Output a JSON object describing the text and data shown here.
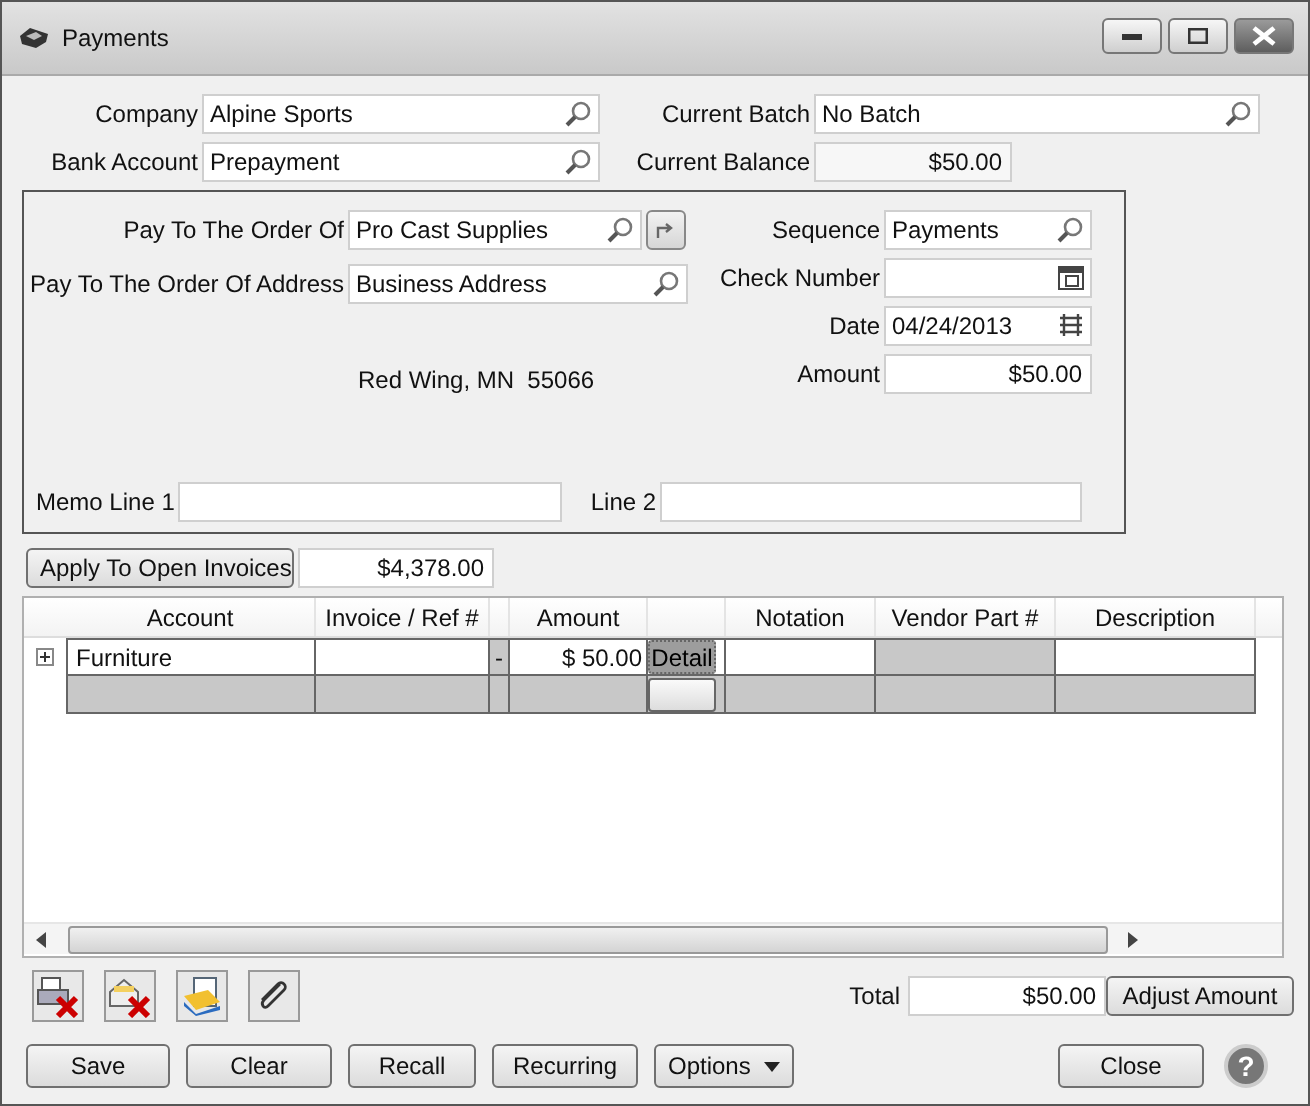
{
  "window": {
    "title": "Payments"
  },
  "top": [
    {
      "label": "Company",
      "value": "Alpine Sports",
      "kind": "lookup"
    },
    {
      "label": "Current Batch",
      "value": "No Batch",
      "kind": "lookup"
    },
    {
      "label": "Bank Account",
      "value": "Prepayment",
      "kind": "lookup"
    },
    {
      "label": "Current Balance",
      "value": "$50.00",
      "kind": "balance"
    }
  ],
  "payee": {
    "left": [
      {
        "label": "Pay To The Order Of",
        "value": "Pro Cast Supplies",
        "kind": "lookup"
      },
      {
        "label": "Pay To The Order Of Address",
        "value": "Business Address",
        "kind": "lookup"
      }
    ],
    "address": "Red Wing, MN  55066",
    "right": [
      {
        "label": "Sequence",
        "value": "Payments",
        "kind": "lookup"
      },
      {
        "label": "Check Number",
        "kind": "calendar"
      },
      {
        "label": "Date",
        "value": "04/24/2013",
        "kind": "date"
      },
      {
        "label": "Amount",
        "value": "$50.00",
        "kind": "amount"
      }
    ],
    "memo": [
      {
        "label": "Memo Line 1"
      },
      {
        "label": "Line 2"
      }
    ]
  },
  "apply": {
    "label": "Apply To Open Invoices",
    "value": "$4,378.00"
  },
  "table": {
    "columns": [
      {
        "label": "Account",
        "readonly": false
      },
      {
        "label": "Invoice / Ref #",
        "readonly": false
      },
      {
        "readonly": true
      },
      {
        "label": "Amount",
        "readonly": false
      },
      {
        "readonly": false
      },
      {
        "label": "Notation",
        "readonly": false
      },
      {
        "label": "Vendor Part #",
        "readonly": true
      },
      {
        "label": "Description",
        "readonly": false
      }
    ],
    "rows": [
      {
        "kind": "entry",
        "account": "Furniture",
        "column_3": "-",
        "amount": "$ 50.00",
        "button": "Detail"
      },
      {
        "kind": "new"
      }
    ]
  },
  "total": {
    "label": "Total",
    "value": "$50.00"
  },
  "adjust_button": "Adjust Amount",
  "buttons": [
    "Save",
    "Clear",
    "Recall",
    "Recurring"
  ],
  "options_button": "Options",
  "close_button": "Close",
  "help": "?"
}
